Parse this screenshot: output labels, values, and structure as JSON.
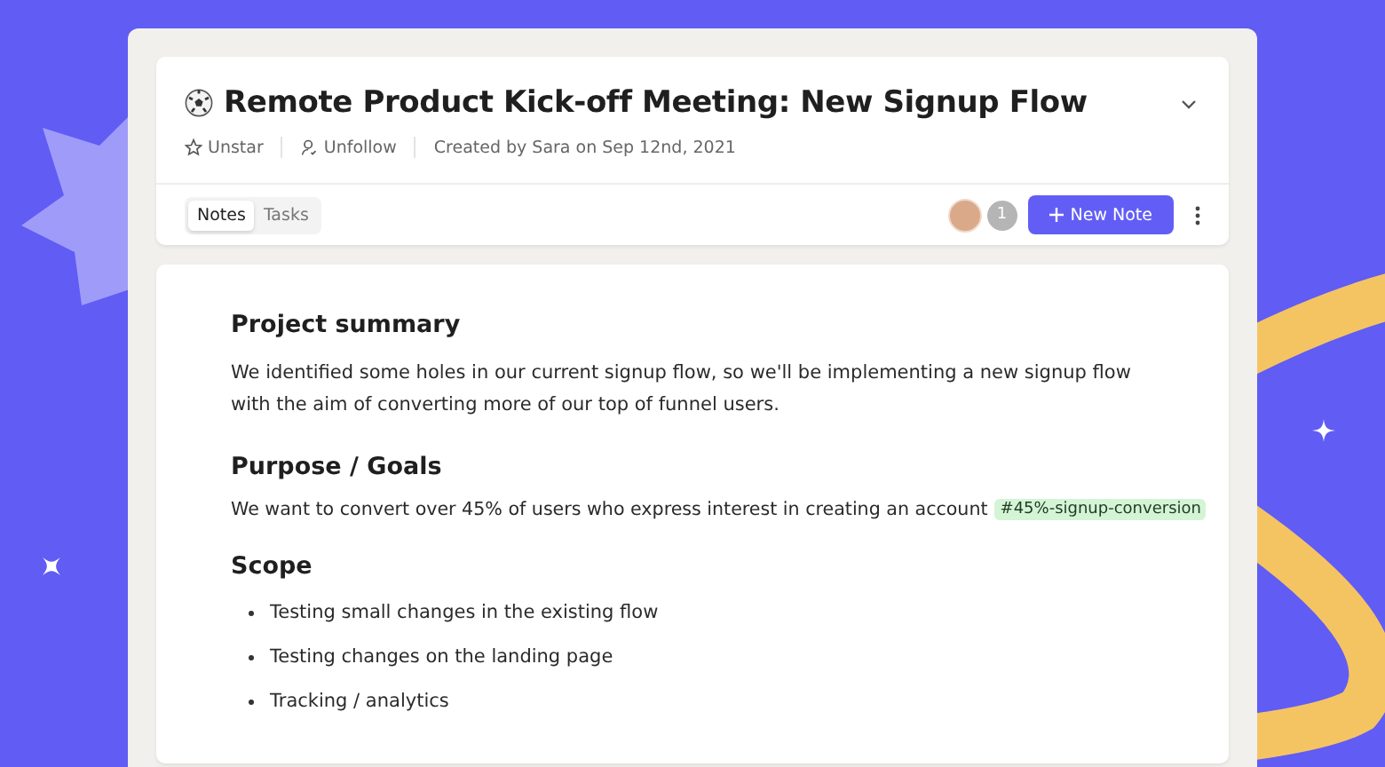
{
  "header": {
    "title": "Remote Product Kick-off Meeting: New Signup Flow",
    "actions": [
      {
        "kind": "star",
        "label": "Unstar"
      },
      {
        "kind": "follow",
        "label": "Unfollow"
      }
    ],
    "meta": "Created by Sara on Sep 12nd, 2021"
  },
  "tabs": [
    {
      "label": "Notes",
      "selected": true
    },
    {
      "label": "Tasks",
      "selected": false
    }
  ],
  "collaborators": {
    "count": "1"
  },
  "new_note_button": "New Note",
  "sections": [
    {
      "heading": "Project summary",
      "kind": "paragraph",
      "lines": [
        "We identified some holes in our current signup flow, so we'll be implementing a new signup flow",
        "with the aim of converting more of our top of funnel users."
      ]
    },
    {
      "heading": "Purpose / Goals",
      "kind": "paragraph",
      "lines": [
        "We want to convert over 45% of users who express interest in creating an account"
      ],
      "tag": "#45%-signup-conversion"
    },
    {
      "heading": "Scope",
      "kind": "list",
      "items": [
        "Testing small changes in the existing flow",
        "Testing changes on the landing page",
        "Tracking / analytics"
      ]
    }
  ]
}
